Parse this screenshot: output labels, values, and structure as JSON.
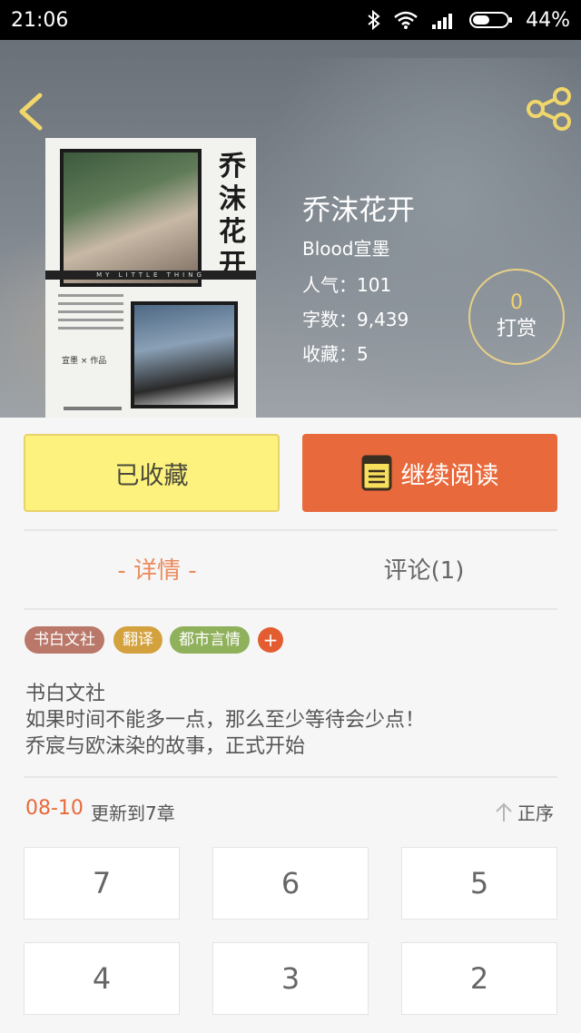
{
  "status_bar": {
    "time": "21:06",
    "battery": "44%",
    "icons": [
      "bluetooth-icon",
      "wifi-icon",
      "signal-icon",
      "battery-icon"
    ]
  },
  "cover": {
    "title_vertical": "乔沫花开",
    "tagline": "MY LITTLE THING",
    "credit": "宣墨 × 作品"
  },
  "book": {
    "title": "乔沫花开",
    "author": "Blood宣墨",
    "popularity": "人气：101",
    "word_count": "字数：9,439",
    "favorites": "收藏：5"
  },
  "reward": {
    "count": "0",
    "label": "打赏"
  },
  "actions": {
    "collected_label": "已收藏",
    "continue_label": "继续阅读"
  },
  "tabs": {
    "detail": "- 详情 -",
    "comments": "评论(1)"
  },
  "tags": [
    {
      "label": "书白文社",
      "color": "#b9786a"
    },
    {
      "label": "翻译",
      "color": "#d3a13e"
    },
    {
      "label": "都市言情",
      "color": "#8fb15b"
    }
  ],
  "tag_add": "+",
  "description": {
    "line1": "书白文社",
    "line2": "如果时间不能多一点，那么至少等待会少点！",
    "line3": "乔宸与欧沫染的故事，正式开始"
  },
  "update": {
    "date": "08-10",
    "text": "更新到7章",
    "sort_label": "正序"
  },
  "chapters": [
    "7",
    "6",
    "5",
    "4",
    "3",
    "2"
  ],
  "colors": {
    "accent": "#e8693b",
    "collect_bg": "#fdf27e",
    "detail_tab": "#ec8a5c"
  }
}
